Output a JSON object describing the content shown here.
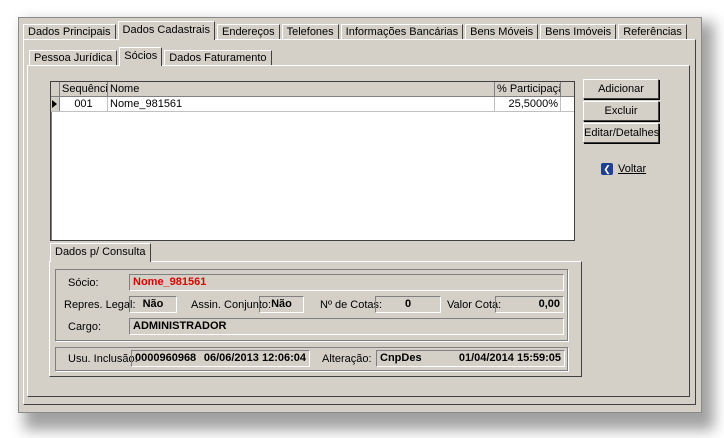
{
  "tabs": [
    "Dados Principais",
    "Dados Cadastrais",
    "Endereços",
    "Telefones",
    "Informações Bancárias",
    "Bens Móveis",
    "Bens Imóveis",
    "Referências"
  ],
  "subtabs": [
    "Pessoa Jurídica",
    "Sócios",
    "Dados Faturamento"
  ],
  "grid": {
    "columns": [
      "Sequência",
      "Nome",
      "% Participação"
    ],
    "rows": [
      {
        "seq": "001",
        "nome": "Nome_981561",
        "pct": "25,5000%"
      }
    ]
  },
  "buttons": {
    "adicionar": "Adicionar",
    "excluir": "Excluir",
    "editar": "Editar/Detalhes",
    "voltar": "Voltar"
  },
  "consulta": {
    "tab": "Dados p/ Consulta",
    "socio_label": "Sócio:",
    "socio_value": "Nome_981561",
    "repres_label": "Repres. Legal:",
    "repres_value": "Não",
    "assin_label": "Assin. Conjunto:",
    "assin_value": "Não",
    "cotas_label": "Nº de Cotas:",
    "cotas_value": "0",
    "valor_label": "Valor Cota:",
    "valor_value": "0,00",
    "cargo_label": "Cargo:",
    "cargo_value": "ADMINISTRADOR",
    "usu_label": "Usu. Inclusão:",
    "usu_value": "0000960968",
    "usu_date": "06/06/2013 12:06:04",
    "alt_label": "Alteração:",
    "alt_value": "CnpDes",
    "alt_date": "01/04/2014 15:59:05"
  },
  "colors": {
    "window_bg": "#d4d0c8",
    "highlight_text": "#e00000"
  }
}
